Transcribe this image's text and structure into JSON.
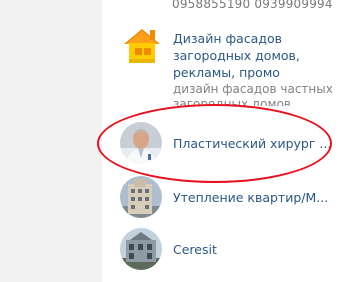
{
  "top_phone": "0958855190 0939909994",
  "items": [
    {
      "title_lines": [
        "Дизайн фасадов",
        "загородных домов,",
        "рекламы, промо"
      ],
      "subtitle_lines": [
        "дизайн фасадов частных",
        "загородных домов"
      ],
      "icon": "house-icon"
    },
    {
      "title": "Пластический хирург ...",
      "icon": "doctor-avatar"
    },
    {
      "title": "Утепление квартир/М...",
      "icon": "building-avatar"
    },
    {
      "title": "Ceresit",
      "icon": "building-avatar"
    }
  ],
  "colors": {
    "link": "#2a5885",
    "highlight_oval": "#e8101c"
  }
}
